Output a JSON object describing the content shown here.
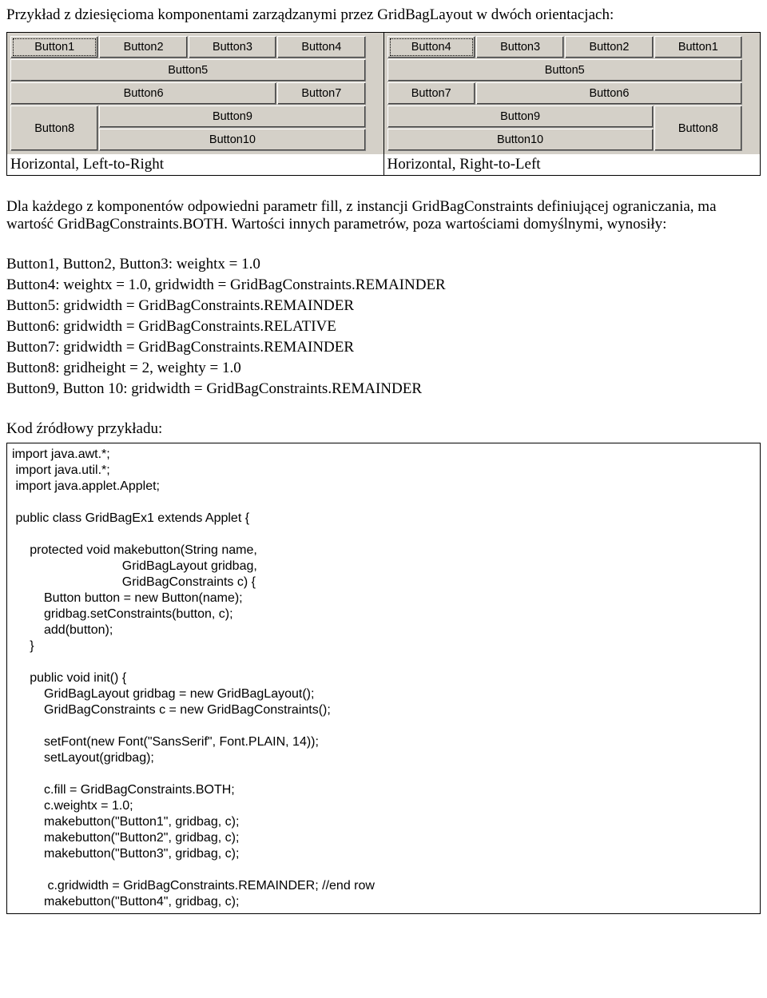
{
  "intro": "Przykład z dziesięcioma komponentami zarządzanymi przez GridBagLayout w dwóch orientacjach:",
  "buttons": {
    "b1": "Button1",
    "b2": "Button2",
    "b3": "Button3",
    "b4": "Button4",
    "b5": "Button5",
    "b6": "Button6",
    "b7": "Button7",
    "b8": "Button8",
    "b9": "Button9",
    "b10": "Button10"
  },
  "captions": {
    "ltr": "Horizontal, Left-to-Right",
    "rtl": "Horizontal, Right-to-Left"
  },
  "para1": "Dla każdego z komponentów odpowiedni parametr fill, z instancji GridBagConstraints definiującej ograniczania, ma wartość GridBagConstraints.BOTH. Wartości innych parametrów, poza wartościami domyślnymi, wynosiły:",
  "constraints": {
    "l1": "Button1, Button2, Button3: weightx = 1.0",
    "l2": "Button4: weightx = 1.0, gridwidth = GridBagConstraints.REMAINDER",
    "l3": "Button5: gridwidth = GridBagConstraints.REMAINDER",
    "l4": "Button6: gridwidth = GridBagConstraints.RELATIVE",
    "l5": "Button7: gridwidth = GridBagConstraints.REMAINDER",
    "l6": "Button8: gridheight = 2, weighty = 1.0",
    "l7": "Button9, Button 10: gridwidth = GridBagConstraints.REMAINDER"
  },
  "para2": "Kod źródłowy przykładu:",
  "code": "import java.awt.*;\n import java.util.*;\n import java.applet.Applet;\n\n public class GridBagEx1 extends Applet {\n\n     protected void makebutton(String name,\n                               GridBagLayout gridbag,\n                               GridBagConstraints c) {\n         Button button = new Button(name);\n         gridbag.setConstraints(button, c);\n         add(button);\n     }\n\n     public void init() {\n         GridBagLayout gridbag = new GridBagLayout();\n         GridBagConstraints c = new GridBagConstraints();\n\n         setFont(new Font(\"SansSerif\", Font.PLAIN, 14));\n         setLayout(gridbag);\n\n         c.fill = GridBagConstraints.BOTH;\n         c.weightx = 1.0;\n         makebutton(\"Button1\", gridbag, c);\n         makebutton(\"Button2\", gridbag, c);\n         makebutton(\"Button3\", gridbag, c);\n\n          c.gridwidth = GridBagConstraints.REMAINDER; //end row\n         makebutton(\"Button4\", gridbag, c);"
}
